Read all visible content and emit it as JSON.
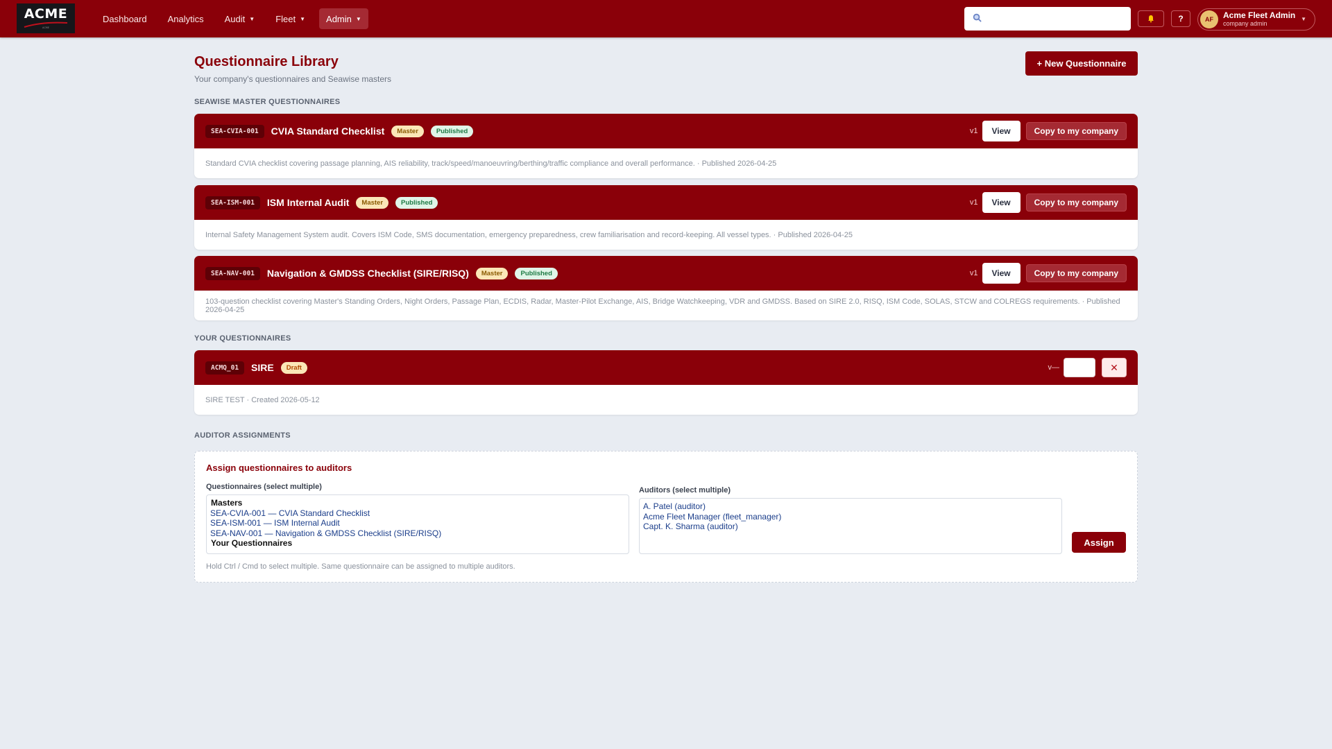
{
  "brand": {
    "logo_text": "ACME",
    "accent": "#8a0009"
  },
  "nav": {
    "items": [
      {
        "label": "Dashboard",
        "dropdown": false
      },
      {
        "label": "Analytics",
        "dropdown": false
      },
      {
        "label": "Audit",
        "dropdown": true
      },
      {
        "label": "Fleet",
        "dropdown": true
      },
      {
        "label": "Admin",
        "dropdown": true,
        "active": true
      }
    ],
    "search_placeholder": "",
    "help_label": "?",
    "user": {
      "initials": "AF",
      "name": "Acme Fleet Admin",
      "role": "company admin"
    }
  },
  "page": {
    "title": "Questionnaire Library",
    "subtitle": "Your company's questionnaires and Seawise masters",
    "new_button": "+ New Questionnaire"
  },
  "sections": {
    "masters_label": "SEAWISE MASTER QUESTIONNAIRES",
    "yours_label": "YOUR QUESTIONNAIRES",
    "assignments_label": "AUDITOR ASSIGNMENTS"
  },
  "masters": [
    {
      "code": "SEA-CVIA-001",
      "title": "CVIA Standard Checklist",
      "badges": [
        "Master",
        "Published"
      ],
      "version": "v1",
      "view_label": "View",
      "copy_label": "Copy to my company",
      "description": "Standard CVIA checklist covering passage planning, AIS reliability, track/speed/manoeuvring/berthing/traffic compliance and overall performance.  ·  Published 2026-04-25"
    },
    {
      "code": "SEA-ISM-001",
      "title": "ISM Internal Audit",
      "badges": [
        "Master",
        "Published"
      ],
      "version": "v1",
      "view_label": "View",
      "copy_label": "Copy to my company",
      "description": "Internal Safety Management System audit. Covers ISM Code, SMS documentation, emergency preparedness, crew familiarisation and record-keeping. All vessel types.  ·  Published 2026-04-25"
    },
    {
      "code": "SEA-NAV-001",
      "title": "Navigation & GMDSS Checklist (SIRE/RISQ)",
      "badges": [
        "Master",
        "Published"
      ],
      "version": "v1",
      "view_label": "View",
      "copy_label": "Copy to my company",
      "description": "103-question checklist covering Master's Standing Orders, Night Orders, Passage Plan, ECDIS, Radar, Master-Pilot Exchange, AIS, Bridge Watchkeeping, VDR and GMDSS. Based on SIRE 2.0, RISQ, ISM Code, SOLAS, STCW and COLREGS requirements.  ·  Published 2026-04-25"
    }
  ],
  "yours": [
    {
      "code": "ACMQ_01",
      "title": "SIRE",
      "badge": "Draft",
      "version": "v—",
      "delete_label": "✕",
      "description": "SIRE TEST  ·  Created 2026-05-12"
    }
  ],
  "assign": {
    "title": "Assign questionnaires to auditors",
    "questionnaires_label": "Questionnaires (select multiple)",
    "auditors_label": "Auditors (select multiple)",
    "questionnaire_groups": [
      {
        "label": "Masters",
        "options": [
          "SEA-CVIA-001 — CVIA Standard Checklist",
          "SEA-ISM-001 — ISM Internal Audit",
          "SEA-NAV-001 — Navigation & GMDSS Checklist (SIRE/RISQ)"
        ]
      },
      {
        "label": "Your Questionnaires",
        "options": []
      }
    ],
    "auditors": [
      "A. Patel (auditor)",
      "Acme Fleet Manager (fleet_manager)",
      "Capt. K. Sharma (auditor)"
    ],
    "assign_button": "Assign",
    "hint": "Hold Ctrl / Cmd to select multiple. Same questionnaire can be assigned to multiple auditors."
  }
}
